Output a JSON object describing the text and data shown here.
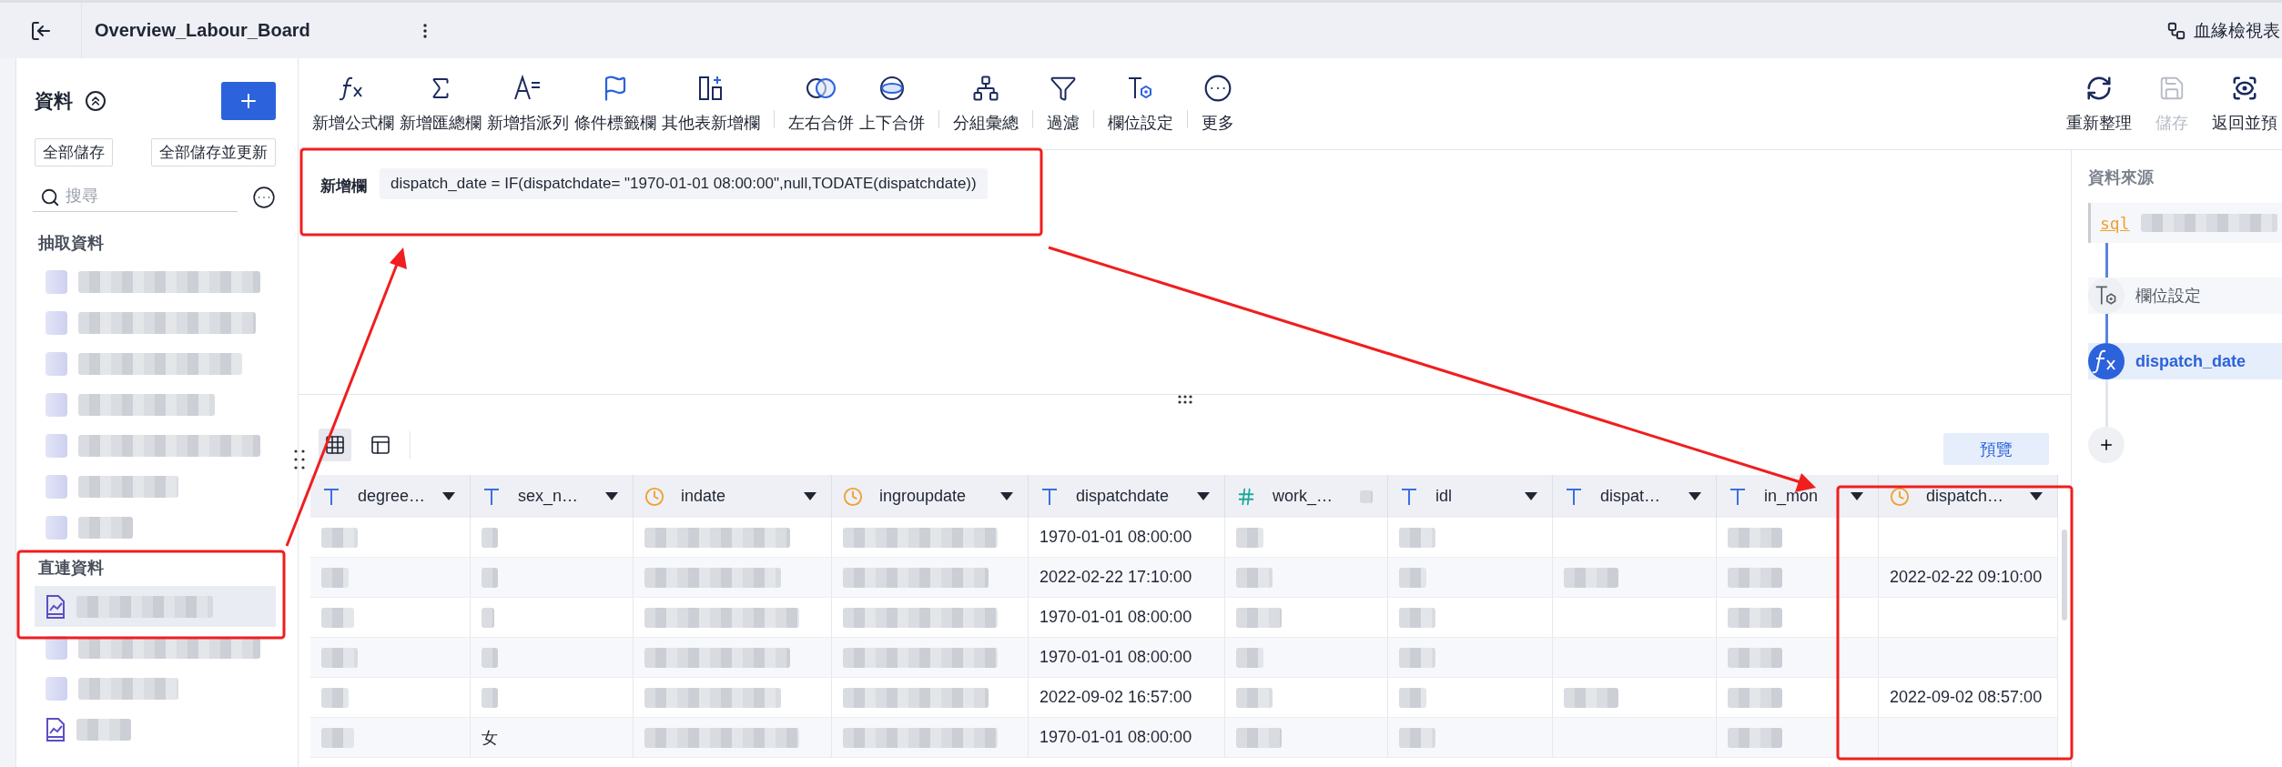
{
  "top_bar": {
    "title": "Overview_Labour_Board",
    "lineage_link": "血緣檢視表"
  },
  "sidebar": {
    "title": "資料",
    "buttons": [
      "全部儲存",
      "全部儲存並更新"
    ],
    "search": {
      "placeholder": "搜尋"
    },
    "groups": [
      {
        "title": "抽取資料",
        "items": [
          {
            "kind": "blurred",
            "selected": false
          },
          {
            "kind": "blurred",
            "selected": false
          },
          {
            "kind": "blurred",
            "selected": false
          },
          {
            "kind": "blurred",
            "selected": false
          },
          {
            "kind": "blurred",
            "selected": false
          },
          {
            "kind": "blurred",
            "selected": false
          },
          {
            "kind": "blurred",
            "selected": false
          }
        ]
      },
      {
        "title": "直連資料",
        "items": [
          {
            "kind": "chart",
            "selected": true
          },
          {
            "kind": "blurred",
            "selected": false
          },
          {
            "kind": "blurred",
            "selected": false
          },
          {
            "kind": "chart",
            "selected": false
          }
        ]
      }
    ]
  },
  "toolbar": {
    "groups": [
      [
        "新增公式欄",
        "新增匯總欄",
        "新增指派列",
        "條件標籤欄",
        "其他表新增欄"
      ],
      [
        "左右合併",
        "上下合併"
      ],
      [
        "分組彙總"
      ],
      [
        "過濾"
      ],
      [
        "欄位設定"
      ],
      [
        "更多"
      ]
    ],
    "actions": [
      {
        "label": "重新整理",
        "disabled": false
      },
      {
        "label": "儲存",
        "disabled": true
      },
      {
        "label": "返回並預",
        "disabled": false
      }
    ]
  },
  "formula": {
    "label": "新增欄",
    "expression": "dispatch_date = IF(dispatchdate= \"1970-01-01 08:00:00\",null,TODATE(dispatchdate))"
  },
  "views": [
    {
      "selected": true
    },
    {
      "selected": false
    }
  ],
  "preview_button": "預覽",
  "table": {
    "columns": [
      {
        "name": "degree…",
        "kind": "text"
      },
      {
        "name": "sex_n…",
        "kind": "text"
      },
      {
        "name": "indate",
        "kind": "date"
      },
      {
        "name": "ingroupdate",
        "kind": "date"
      },
      {
        "name": "dispatchdate",
        "kind": "text"
      },
      {
        "name": "work_…",
        "kind": "number"
      },
      {
        "name": "idl",
        "kind": "text"
      },
      {
        "name": "dispat…",
        "kind": "text"
      },
      {
        "name": "in_mon",
        "kind": "text"
      },
      {
        "name": "dispatch…",
        "kind": "date"
      }
    ],
    "rows": [
      {
        "cells": [
          {
            "kind": "blurred"
          },
          {
            "kind": "blurred"
          },
          {
            "kind": "blurred"
          },
          {
            "kind": "blurred"
          },
          {
            "kind": "text",
            "text": "1970-01-01 08:00:00"
          },
          {
            "kind": "blurred"
          },
          {
            "kind": "blurred"
          },
          {
            "kind": "empty"
          },
          {
            "kind": "blurred"
          },
          {
            "kind": "empty"
          }
        ]
      },
      {
        "cells": [
          {
            "kind": "blurred"
          },
          {
            "kind": "blurred"
          },
          {
            "kind": "blurred"
          },
          {
            "kind": "blurred"
          },
          {
            "kind": "text",
            "text": "2022-02-22 17:10:00"
          },
          {
            "kind": "blurred"
          },
          {
            "kind": "blurred"
          },
          {
            "kind": "blurred"
          },
          {
            "kind": "blurred"
          },
          {
            "kind": "text",
            "text": "2022-02-22 09:10:00"
          }
        ]
      },
      {
        "cells": [
          {
            "kind": "blurred"
          },
          {
            "kind": "blurred"
          },
          {
            "kind": "blurred"
          },
          {
            "kind": "blurred"
          },
          {
            "kind": "text",
            "text": "1970-01-01 08:00:00"
          },
          {
            "kind": "blurred"
          },
          {
            "kind": "blurred"
          },
          {
            "kind": "empty"
          },
          {
            "kind": "blurred"
          },
          {
            "kind": "empty"
          }
        ]
      },
      {
        "cells": [
          {
            "kind": "blurred"
          },
          {
            "kind": "blurred"
          },
          {
            "kind": "blurred"
          },
          {
            "kind": "blurred"
          },
          {
            "kind": "text",
            "text": "1970-01-01 08:00:00"
          },
          {
            "kind": "blurred"
          },
          {
            "kind": "blurred"
          },
          {
            "kind": "empty"
          },
          {
            "kind": "blurred"
          },
          {
            "kind": "empty"
          }
        ]
      },
      {
        "cells": [
          {
            "kind": "blurred"
          },
          {
            "kind": "blurred"
          },
          {
            "kind": "blurred"
          },
          {
            "kind": "blurred"
          },
          {
            "kind": "text",
            "text": "2022-09-02 16:57:00"
          },
          {
            "kind": "blurred"
          },
          {
            "kind": "blurred"
          },
          {
            "kind": "blurred"
          },
          {
            "kind": "blurred"
          },
          {
            "kind": "text",
            "text": "2022-09-02 08:57:00"
          }
        ]
      },
      {
        "cells": [
          {
            "kind": "blurred"
          },
          {
            "kind": "text",
            "text": "女"
          },
          {
            "kind": "blurred"
          },
          {
            "kind": "blurred"
          },
          {
            "kind": "text",
            "text": "1970-01-01 08:00:00"
          },
          {
            "kind": "blurred"
          },
          {
            "kind": "blurred"
          },
          {
            "kind": "empty"
          },
          {
            "kind": "blurred"
          },
          {
            "kind": "empty"
          }
        ]
      }
    ]
  },
  "source_panel": {
    "title": "資料來源",
    "steps": [
      {
        "kind": "source",
        "label": "sql",
        "selected": false
      },
      {
        "kind": "field-settings",
        "label": "欄位設定",
        "selected": false
      },
      {
        "kind": "formula",
        "label": "dispatch_date",
        "selected": true
      }
    ]
  }
}
